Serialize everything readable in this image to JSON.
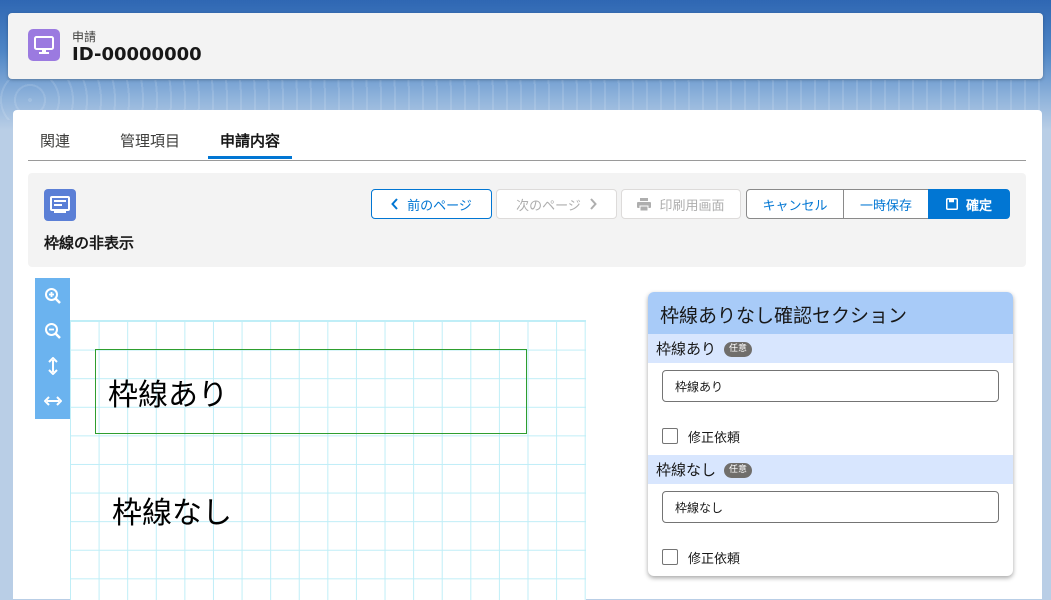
{
  "header": {
    "object_label": "申請",
    "record_id": "ID-00000000",
    "icon": "desktop-icon"
  },
  "tabs": [
    {
      "label": "関連",
      "active": false
    },
    {
      "label": "管理項目",
      "active": false
    },
    {
      "label": "申請内容",
      "active": true
    }
  ],
  "toolbar": {
    "icon": "form-icon",
    "title": "枠線の非表示",
    "buttons": {
      "prev": "前のページ",
      "next": "次のページ",
      "print": "印刷用画面",
      "cancel": "キャンセル",
      "temp_save": "一時保存",
      "confirm": "確定"
    }
  },
  "zoom_tools": [
    "zoom-in-icon",
    "zoom-out-icon",
    "fit-height-icon",
    "fit-width-icon"
  ],
  "canvas": {
    "label_with_border": "枠線あり",
    "label_without_border": "枠線なし"
  },
  "panel": {
    "title": "枠線ありなし確認セクション",
    "fields": [
      {
        "label": "枠線あり",
        "badge": "任意",
        "value": "枠線あり",
        "check_label": "修正依頼"
      },
      {
        "label": "枠線なし",
        "badge": "任意",
        "value": "枠線なし",
        "check_label": "修正依頼"
      }
    ]
  },
  "colors": {
    "brand": "#0176d3",
    "panel_header": "#a8cbf8",
    "field_label_bg": "#d8e6fe",
    "grid_line": "#bfeef7",
    "frame_border": "#2e9e2e"
  }
}
